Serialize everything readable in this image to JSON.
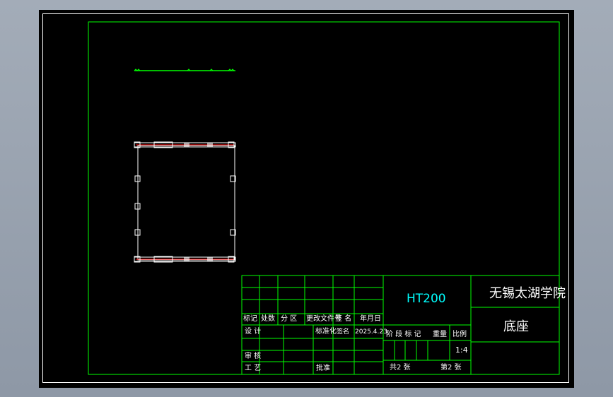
{
  "title_block": {
    "material": "HT200",
    "school": "无锡太湖学院",
    "part_name": "底座",
    "scale": "1:4",
    "labels": {
      "mark": "标记",
      "count": "处数",
      "zone": "分 区",
      "change_doc": "更改文件号",
      "signature": "签 名",
      "date": "年月日",
      "design": "设 计",
      "standardize": "标准化",
      "signature2": "签名",
      "review": "审 核",
      "process": "工 艺",
      "approve": "批准",
      "stage_mark": "阶 段 标 记",
      "weight": "重量",
      "scale_label": "比例",
      "total_sheets": "共2 张",
      "sheet_no": "第2 张"
    },
    "design_date": "2025.4.23"
  },
  "colors": {
    "frame_green": "#00ff00",
    "text_cyan": "#00ffff",
    "part_white": "#ffffff",
    "accent_red": "#ff0000"
  }
}
